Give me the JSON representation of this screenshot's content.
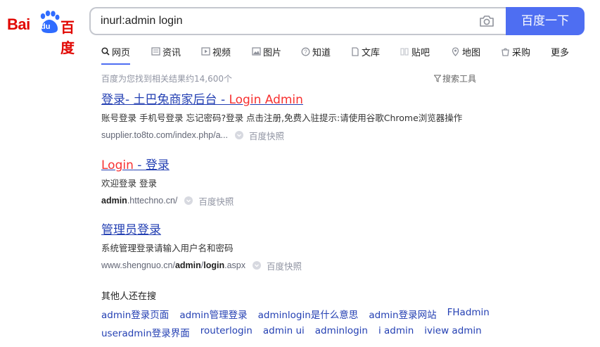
{
  "logo": {
    "text_latin": "Bai",
    "text_du": "du",
    "text_cn": "百度"
  },
  "search": {
    "query": "inurl:admin login",
    "button_label": "百度一下"
  },
  "tabs": [
    {
      "label": "网页",
      "icon": "search-icon"
    },
    {
      "label": "资讯",
      "icon": "news-icon"
    },
    {
      "label": "视频",
      "icon": "video-icon"
    },
    {
      "label": "图片",
      "icon": "image-icon"
    },
    {
      "label": "知道",
      "icon": "question-icon"
    },
    {
      "label": "文库",
      "icon": "doc-icon"
    },
    {
      "label": "贴吧",
      "icon": "tieba-icon"
    },
    {
      "label": "地图",
      "icon": "map-icon"
    },
    {
      "label": "采购",
      "icon": "shop-icon"
    },
    {
      "label": "更多",
      "icon": ""
    }
  ],
  "result_count": "百度为您找到相关结果约14,600个",
  "tools_label": "搜索工具",
  "results": [
    {
      "title_a": "登录- 土巴兔商家后台 - ",
      "title_b": "Login Admin",
      "abstract": "账号登录 手机号登录 忘记密码?登录 点击注册,免费入驻提示:请使用谷歌Chrome浏览器操作",
      "url": "supplier.to8to.com/index.php/a...",
      "snapshot": "百度快照"
    },
    {
      "title_a": "Login",
      "title_b": " - 登录",
      "abstract": "欢迎登录 登录",
      "url_bold": "admin",
      "url_rest": ".httechno.cn/",
      "snapshot": "百度快照"
    },
    {
      "title": "管理员登录",
      "abstract": "系统管理登录请输入用户名和密码",
      "url_pre": "www.shengnuo.cn/",
      "url_bold1": "admin",
      "url_mid": "/",
      "url_bold2": "login",
      "url_post": ".aspx",
      "snapshot": "百度快照"
    }
  ],
  "others": {
    "title": "其他人还在搜",
    "row1": [
      "admin登录页面",
      "admin管理登录",
      "adminlogin是什么意思",
      "admin登录网站",
      "FHadmin"
    ],
    "row2": [
      "useradmin登录界面",
      "routerlogin",
      "admin ui",
      "adminlogin",
      "i admin",
      "iview admin"
    ]
  },
  "colors": {
    "brand_red": "#e10601",
    "accent_blue": "#4e6ef2",
    "link_blue": "#2440b3",
    "highlight_red": "#f73131"
  }
}
